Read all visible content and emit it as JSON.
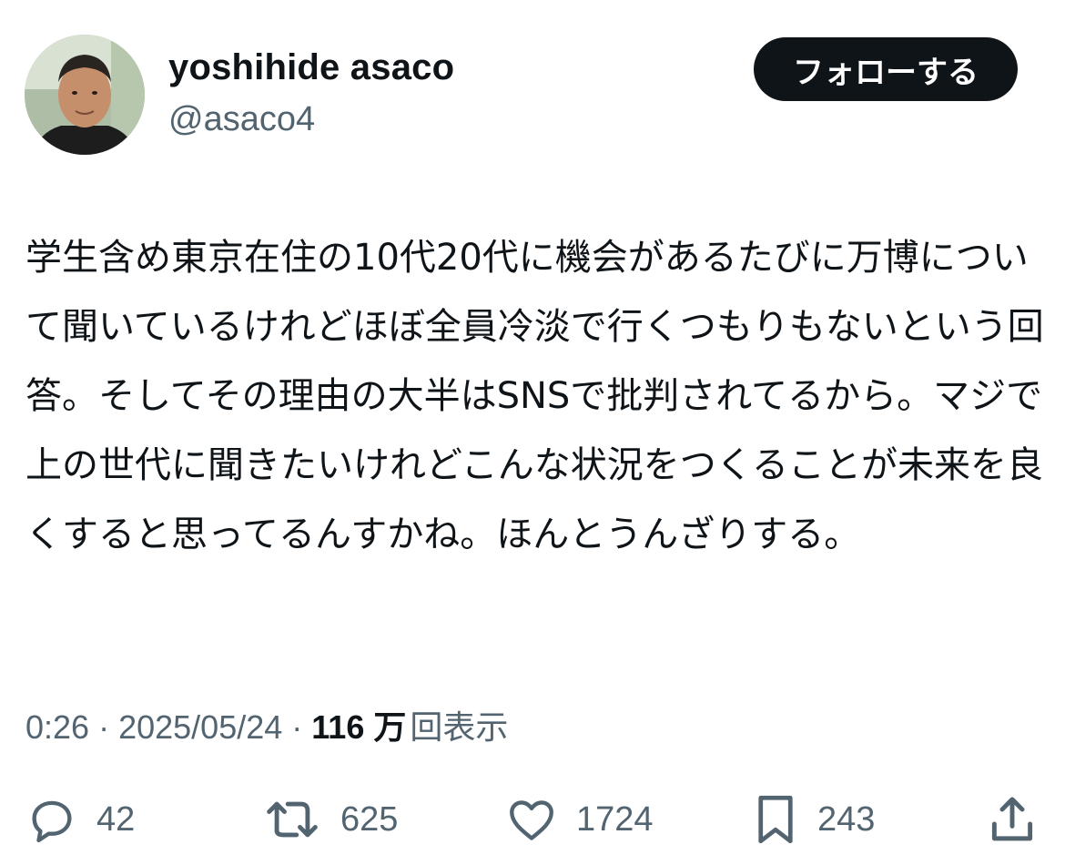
{
  "author": {
    "name": "yoshihide asaco",
    "handle": "@asaco4"
  },
  "follow_button": {
    "label": "フォローする"
  },
  "tweet": {
    "text": "学生含め東京在住の10代20代に機会があるたびに万博について聞いているけれどほぼ全員冷淡で行くつもりもないという回答。そしてその理由の大半はSNSで批判されてるから。マジで上の世代に聞きたいけれどこんな状況をつくることが未来を良くすると思ってるんすかね。ほんとうんざりする。"
  },
  "meta": {
    "time": "0:26",
    "separator": " · ",
    "date": "2025/05/24",
    "views_count": "116 万",
    "views_label": "回表示"
  },
  "actions": {
    "reply": {
      "icon": "reply-icon",
      "count": "42"
    },
    "retweet": {
      "icon": "retweet-icon",
      "count": "625"
    },
    "like": {
      "icon": "heart-icon",
      "count": "1724"
    },
    "bookmark": {
      "icon": "bookmark-icon",
      "count": "243"
    },
    "share": {
      "icon": "share-icon"
    }
  },
  "colors": {
    "text_primary": "#0f1419",
    "text_secondary": "#536471",
    "button_bg": "#0f1419",
    "button_text": "#ffffff"
  }
}
